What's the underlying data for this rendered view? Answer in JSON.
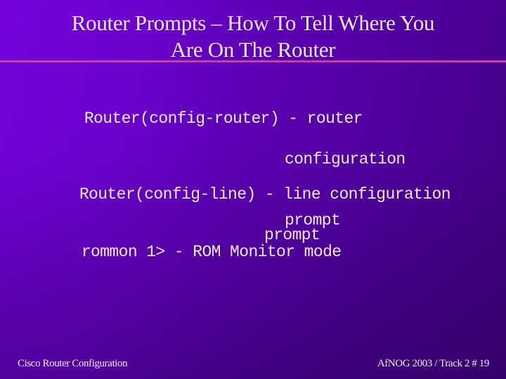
{
  "slide": {
    "title": {
      "line1": "Router Prompts – How To Tell Where You",
      "line2": "Are On The Router"
    },
    "items": [
      {
        "prompt_line": "Router(config-router) - router",
        "continuation": [
          "configuration",
          "prompt"
        ]
      },
      {
        "prompt_line": "Router(config-line) - line configuration",
        "continuation": [
          "prompt"
        ]
      },
      {
        "prompt_line": "rommon 1> - ROM Monitor mode",
        "continuation": []
      }
    ],
    "footer": {
      "left": "Cisco Router Configuration",
      "right": "AfNOG 2003 / Track 2  # 19"
    }
  },
  "colors": {
    "background_top_left": "#7402dc",
    "background_right": "#420080",
    "divider": "#c040b8",
    "text": "#f2eaf6"
  }
}
